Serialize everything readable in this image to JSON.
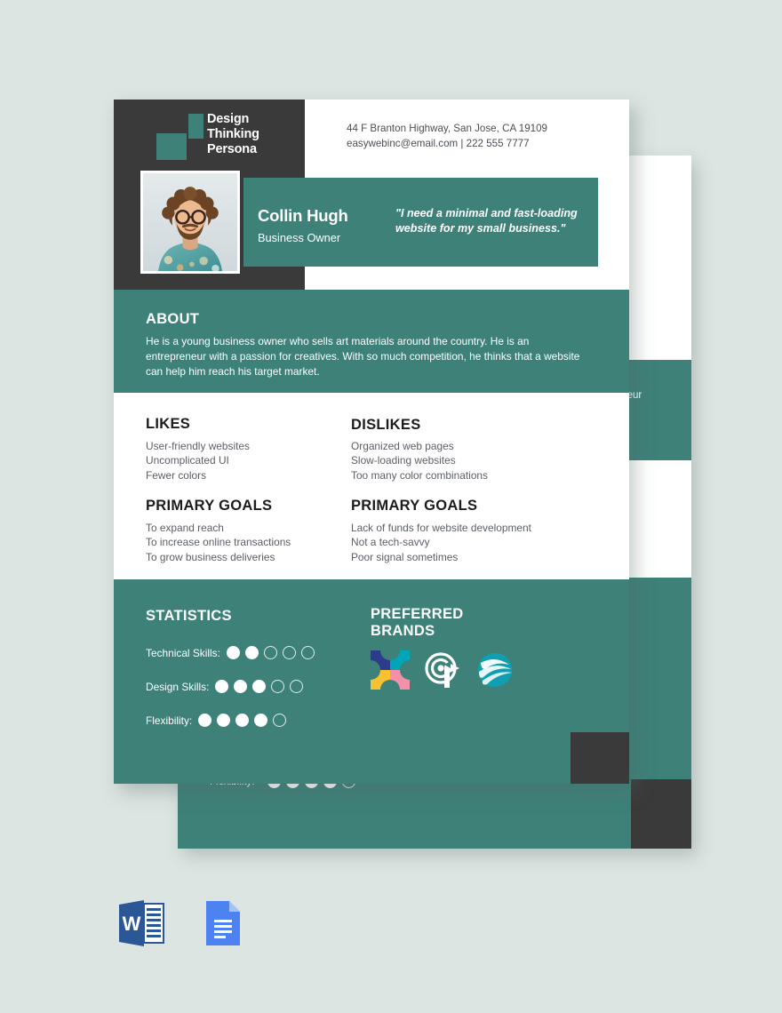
{
  "background_color": "#dce5e2",
  "brand": {
    "teal": "#3d8179",
    "dark": "#3a3a3a",
    "white": "#ffffff"
  },
  "header": {
    "logo_name": "design-thinking-logo",
    "logo_title": "Design\nThinking\nPersona",
    "logo_line1": "Design",
    "logo_line2": "Thinking",
    "logo_line3": "Persona",
    "address": "44 F Branton Highway, San Jose, CA 19109",
    "email_phone": "easywebinc@email.com | 222 555 7777"
  },
  "persona": {
    "photo_alt": "portrait-photo",
    "name": "Collin Hugh",
    "role": "Business Owner",
    "quote": "\"I need a minimal and fast-loading website for my small business.\""
  },
  "about": {
    "title": "ABOUT",
    "text": "He is a young business owner who sells art materials around the country. He is an entrepreneur with a passion for creatives. With so much competition, he thinks that a website can help him reach his target market."
  },
  "columns": {
    "likes": {
      "title": "LIKES",
      "items": [
        "User-friendly websites",
        "Uncomplicated UI",
        "Fewer colors"
      ]
    },
    "dislikes": {
      "title": "DISLIKES",
      "items": [
        "Organized web pages",
        "Slow-loading websites",
        "Too many color combinations"
      ]
    },
    "goals_left": {
      "title": "PRIMARY GOALS",
      "items": [
        "To expand reach",
        "To increase online transactions",
        "To grow business deliveries"
      ]
    },
    "goals_right": {
      "title": "PRIMARY GOALS",
      "items": [
        "Lack of funds for website development",
        "Not a tech-savvy",
        "Poor signal sometimes"
      ]
    }
  },
  "statistics": {
    "title": "STATISTICS",
    "max": 5,
    "rows": [
      {
        "label": "Technical Skills:",
        "value": 2
      },
      {
        "label": "Design Skills:",
        "value": 3
      },
      {
        "label": "Flexibility:",
        "value": 4
      }
    ]
  },
  "preferred_brands": {
    "title_line1": "PREFERRED",
    "title_line2": "BRANDS",
    "logos": [
      {
        "name": "quadrant-square-logo",
        "colors": [
          "#2d3c8a",
          "#00a6b8",
          "#f7c131",
          "#f490a8"
        ]
      },
      {
        "name": "target-arrow-logo",
        "colors": [
          "#ffffff"
        ]
      },
      {
        "name": "globe-swoosh-logo",
        "colors": [
          "#0f9fb0",
          "#18b6c4",
          "#0b7f93"
        ]
      }
    ]
  },
  "file_formats": [
    {
      "name": "microsoft-word-icon",
      "label": "W",
      "color": "#2b5797"
    },
    {
      "name": "google-docs-icon",
      "label": "Docs",
      "color": "#4d82f3"
    }
  ]
}
